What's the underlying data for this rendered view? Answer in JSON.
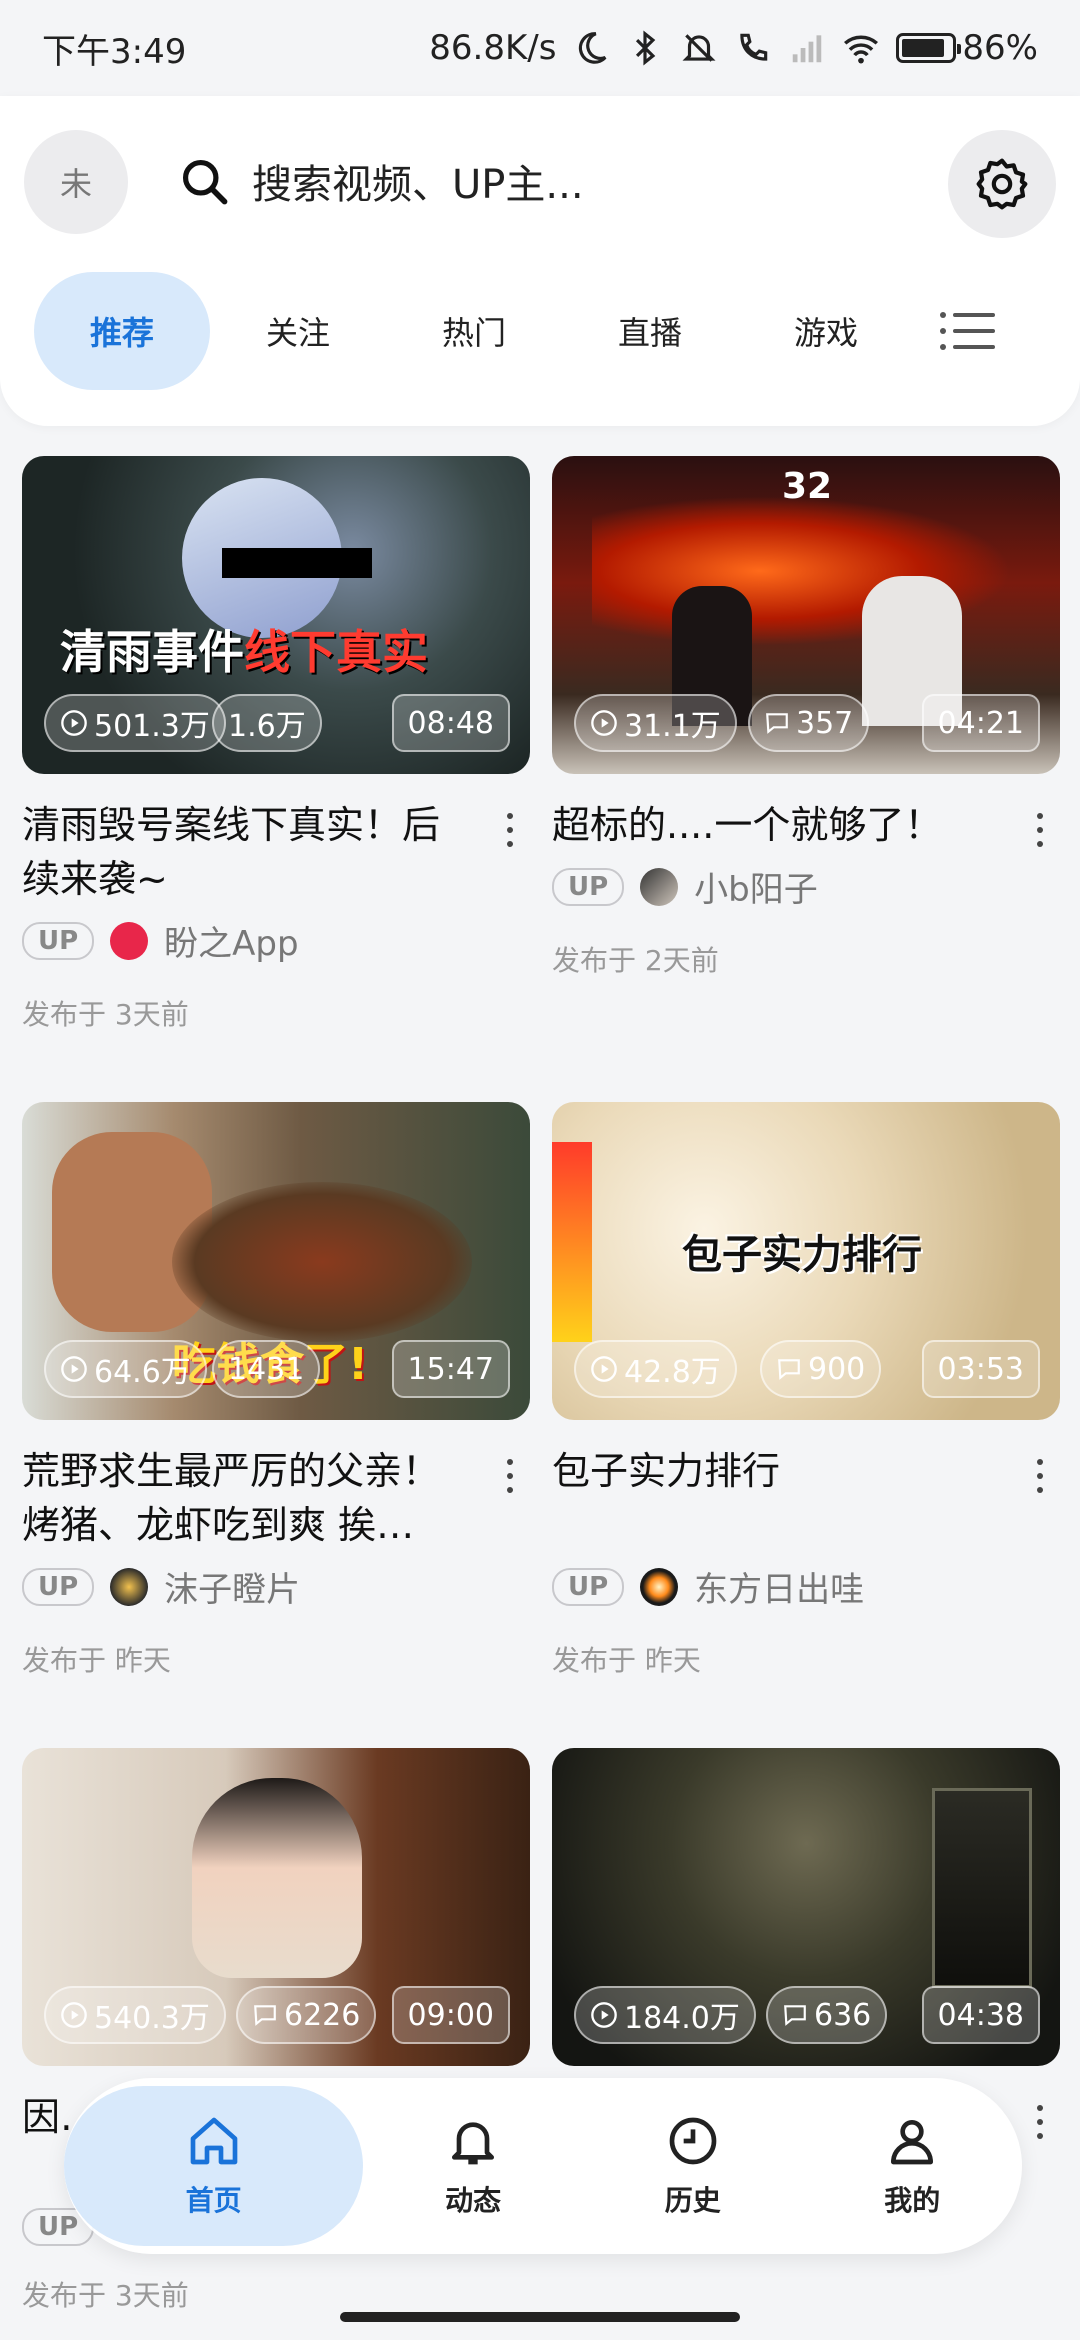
{
  "status": {
    "time": "下午3:49",
    "net_speed": "86.8K/s",
    "battery": "86%"
  },
  "header": {
    "avatar_text": "未",
    "search_placeholder": "搜索视频、UP主...",
    "tabs": [
      "推荐",
      "关注",
      "热门",
      "直播",
      "游戏"
    ],
    "active_tab": "推荐"
  },
  "feed": [
    {
      "thumb_text_1": "清雨事件",
      "thumb_text_2": "线下真实",
      "views": "501.3万",
      "comments": "1.6万",
      "duration": "08:48",
      "title": "清雨毁号案线下真实！后续来袭~",
      "up_badge": "UP",
      "author": "盼之App",
      "date": "发布于 3天前"
    },
    {
      "thumb_text_1": "32",
      "views": "31.1万",
      "comments": "357",
      "duration": "04:21",
      "title": "超标的....一个就够了！",
      "up_badge": "UP",
      "author": "小b阳子",
      "date": "发布于 2天前"
    },
    {
      "thumb_text_1": "吃钱食了!",
      "views": "64.6万",
      "comments": "1431",
      "duration": "15:47",
      "title": "荒野求生最严厉的父亲！烤猪、龙虾吃到爽 挨…",
      "up_badge": "UP",
      "author": "沫子瞪片",
      "date": "发布于 昨天"
    },
    {
      "thumb_text_1": "包子实力排行",
      "views": "42.8万",
      "comments": "900",
      "duration": "03:53",
      "title": "包子实力排行",
      "up_badge": "UP",
      "author": "东方日出哇",
      "date": "发布于 昨天"
    },
    {
      "views": "540.3万",
      "comments": "6226",
      "duration": "09:00",
      "title": "因… 所…",
      "up_badge": "UP",
      "date": "发布于 3天前"
    },
    {
      "views": "184.0万",
      "comments": "636",
      "duration": "04:38"
    }
  ],
  "bottom_nav": [
    {
      "label": "首页",
      "icon": "home-icon"
    },
    {
      "label": "动态",
      "icon": "bell-icon"
    },
    {
      "label": "历史",
      "icon": "clock-icon"
    },
    {
      "label": "我的",
      "icon": "person-icon"
    }
  ],
  "colors": {
    "accent": "#1a73d9",
    "active_bg": "#d8e9fb"
  }
}
